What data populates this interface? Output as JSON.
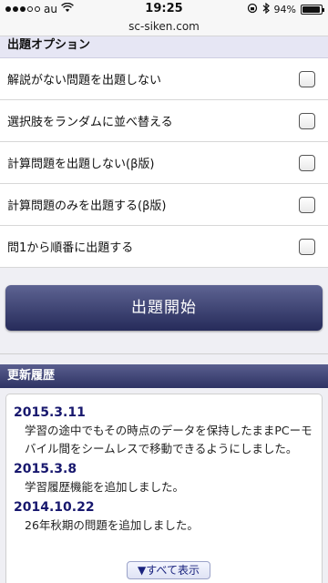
{
  "status_bar": {
    "carrier": "au",
    "time": "19:25",
    "battery": "94%",
    "battery_level": 0.94
  },
  "url_bar": {
    "url": "sc-siken.com"
  },
  "options": {
    "header": "出題オプション",
    "items": [
      {
        "label": "解説がない問題を出題しない",
        "checked": false
      },
      {
        "label": "選択肢をランダムに並べ替える",
        "checked": false
      },
      {
        "label": "計算問題を出題しない(β版)",
        "checked": false
      },
      {
        "label": "計算問題のみを出題する(β版)",
        "checked": false
      },
      {
        "label": "問1から順番に出題する",
        "checked": false
      }
    ]
  },
  "start_button": {
    "label": "出題開始"
  },
  "history": {
    "header": "更新履歴",
    "entries": [
      {
        "date": "2015.3.11",
        "text": "学習の途中でもその時点のデータを保持したままPCーモバイル間をシームレスで移動できるようにしました。"
      },
      {
        "date": "2015.3.8",
        "text": "学習履歴機能を追加しました。"
      },
      {
        "date": "2014.10.22",
        "text": "26年秋期の問題を追加しました。"
      }
    ],
    "show_all": "▼すべて表示"
  },
  "colors": {
    "accent": "#2e3364",
    "date_text": "#18186e",
    "option_header_bg": "#e6e6f4"
  }
}
